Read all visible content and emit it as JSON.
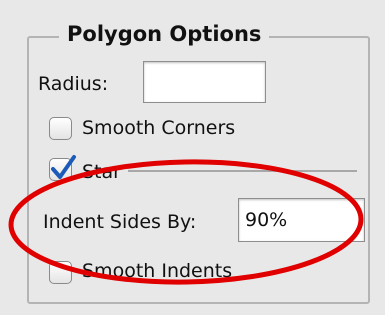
{
  "group": {
    "title": "Polygon Options"
  },
  "radius": {
    "label": "Radius:",
    "value": ""
  },
  "smooth_corners": {
    "label": "Smooth Corners",
    "checked": false
  },
  "star": {
    "label": "Star",
    "checked": true
  },
  "indent_sides": {
    "label": "Indent Sides By:",
    "value": "90%"
  },
  "smooth_indents": {
    "label": "Smooth Indents",
    "checked": false
  },
  "colors": {
    "panel_bg": "#e8e8e8",
    "highlight_ellipse": "#e00000",
    "checkmark": "#1d5bb8"
  }
}
